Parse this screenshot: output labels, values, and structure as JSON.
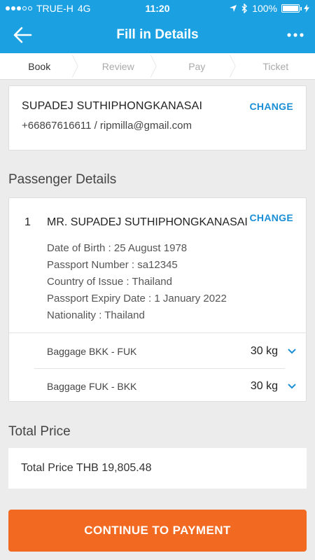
{
  "status_bar": {
    "carrier": "TRUE-H",
    "network": "4G",
    "time": "11:20",
    "battery": "100%"
  },
  "header": {
    "title": "Fill in Details",
    "back_icon": "back-arrow-icon",
    "more_icon": "more-dots-icon"
  },
  "steps": [
    {
      "label": "Book",
      "active": true
    },
    {
      "label": "Review",
      "active": false
    },
    {
      "label": "Pay",
      "active": false
    },
    {
      "label": "Ticket",
      "active": false
    }
  ],
  "contact": {
    "name": "SUPADEJ SUTHIPHONGKANASAI",
    "info": "+66867616611 / ripmilla@gmail.com",
    "change_label": "CHANGE"
  },
  "passenger_section": {
    "title": "Passenger Details",
    "passenger": {
      "number": "1",
      "name": "MR. SUPADEJ SUTHIPHONGKANASAI",
      "change_label": "CHANGE",
      "details": [
        "Date of Birth : 25 August 1978",
        "Passport Number : sa12345",
        "Country of Issue : Thailand",
        "Passport Expiry Date : 1 January 2022",
        "Nationality : Thailand"
      ],
      "baggage": [
        {
          "route": "Baggage BKK - FUK",
          "weight": "30 kg"
        },
        {
          "route": "Baggage FUK - BKK",
          "weight": "30 kg"
        }
      ]
    }
  },
  "total_section": {
    "title": "Total Price",
    "value": "Total Price THB 19,805.48"
  },
  "cta_label": "CONTINUE TO PAYMENT",
  "colors": {
    "primary": "#1ba0e2",
    "link": "#1b8fd6",
    "cta": "#f26a22",
    "background": "#ececec"
  }
}
